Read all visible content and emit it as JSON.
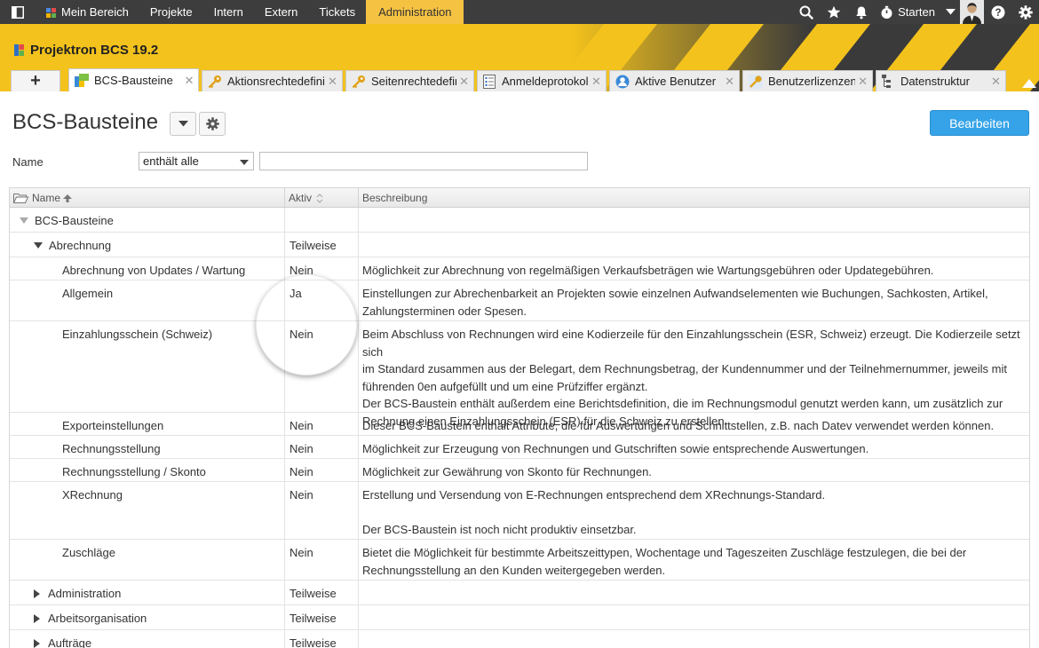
{
  "topnav": {
    "items": [
      {
        "label": "Mein Bereich"
      },
      {
        "label": "Projekte"
      },
      {
        "label": "Intern"
      },
      {
        "label": "Extern"
      },
      {
        "label": "Tickets"
      },
      {
        "label": "Administration"
      }
    ],
    "start_label": "Starten",
    "colors": {
      "bar": "#3d3d3d",
      "active": "#f5c242"
    }
  },
  "app": {
    "title": "Projektron BCS 19.2"
  },
  "tabs": {
    "add_label": "+",
    "items": [
      {
        "label": "BCS-Bausteine",
        "icon": "bcs-module-icon"
      },
      {
        "label": "Aktionsrechtedefiniti",
        "icon": "key-icon"
      },
      {
        "label": "Seitenrechtedefinit",
        "icon": "key-icon"
      },
      {
        "label": "Anmeldeprotokoll",
        "icon": "list-icon"
      },
      {
        "label": "Aktive Benutzer",
        "icon": "user-icon"
      },
      {
        "label": "Benutzerlizenzen",
        "icon": "license-key-icon"
      },
      {
        "label": "Datenstruktur",
        "icon": "tree-structure-icon"
      }
    ],
    "close_glyph": "✕"
  },
  "page": {
    "title": "BCS-Bausteine",
    "edit_label": "Bearbeiten",
    "accent": "#36a3e8"
  },
  "filter": {
    "label": "Name",
    "operator": "enthält alle",
    "value": ""
  },
  "table": {
    "columns": {
      "name": "Name",
      "active": "Aktiv",
      "description": "Beschreibung"
    },
    "rows": [
      {
        "name": "BCS-Bausteine",
        "active": "",
        "desc": []
      },
      {
        "name": "Abrechnung",
        "active": "Teilweise",
        "desc": []
      },
      {
        "name": "Abrechnung von Updates / Wartung",
        "active": "Nein",
        "desc": [
          "Möglichkeit zur Abrechnung von regelmäßigen Verkaufsbeträgen wie Wartungsgebühren oder Updategebühren."
        ]
      },
      {
        "name": "Allgemein",
        "active": "Ja",
        "desc": [
          "Einstellungen zur Abrechenbarkeit an Projekten sowie einzelnen Aufwandselementen wie Buchungen, Sachkosten, Artikel,",
          "Zahlungsterminen oder Spesen."
        ]
      },
      {
        "name": "Einzahlungsschein (Schweiz)",
        "active": "Nein",
        "desc": [
          "Beim Abschluss von Rechnungen wird eine Kodierzeile für den Einzahlungsschein (ESR, Schweiz) erzeugt. Die Kodierzeile setzt sich",
          "im Standard zusammen aus der Belegart, dem Rechnungsbetrag, der Kundennummer und der Teilnehmernummer, jeweils mit",
          "führenden 0en aufgefüllt und um eine Prüfziffer ergänzt.",
          "Der BCS-Baustein enthält außerdem eine Berichtsdefinition, die im Rechnungsmodul genutzt werden kann, um zusätzlich zur",
          "Rechnung einen Einzahlungsschein (ESR) für die Schweiz zu erstellen."
        ]
      },
      {
        "name": "Exporteinstellungen",
        "active": "Nein",
        "desc": [
          "Dieser BCS-Baustein enthält Attribute, die für Auswertungen und Schnittstellen, z.B. nach Datev verwendet werden können."
        ]
      },
      {
        "name": "Rechnungsstellung",
        "active": "Nein",
        "desc": [
          "Möglichkeit zur Erzeugung von Rechnungen und Gutschriften sowie entsprechende Auswertungen."
        ]
      },
      {
        "name": "Rechnungsstellung / Skonto",
        "active": "Nein",
        "desc": [
          "Möglichkeit zur Gewährung von Skonto für Rechnungen."
        ]
      },
      {
        "name": "XRechnung",
        "active": "Nein",
        "desc": [
          "Erstellung und Versendung von E-Rechnungen entsprechend dem XRechnungs-Standard.",
          "",
          "Der BCS-Baustein ist noch nicht produktiv einsetzbar."
        ]
      },
      {
        "name": "Zuschläge",
        "active": "Nein",
        "desc": [
          "Bietet die Möglichkeit für bestimmte Arbeitszeittypen, Wochentage und Tageszeiten Zuschläge festzulegen, die bei der",
          "Rechnungsstellung an den Kunden weitergegeben werden."
        ]
      },
      {
        "name": "Administration",
        "active": "Teilweise",
        "desc": []
      },
      {
        "name": "Arbeitsorganisation",
        "active": "Teilweise",
        "desc": []
      },
      {
        "name": "Aufträge",
        "active": "Teilweise",
        "desc": []
      }
    ]
  }
}
